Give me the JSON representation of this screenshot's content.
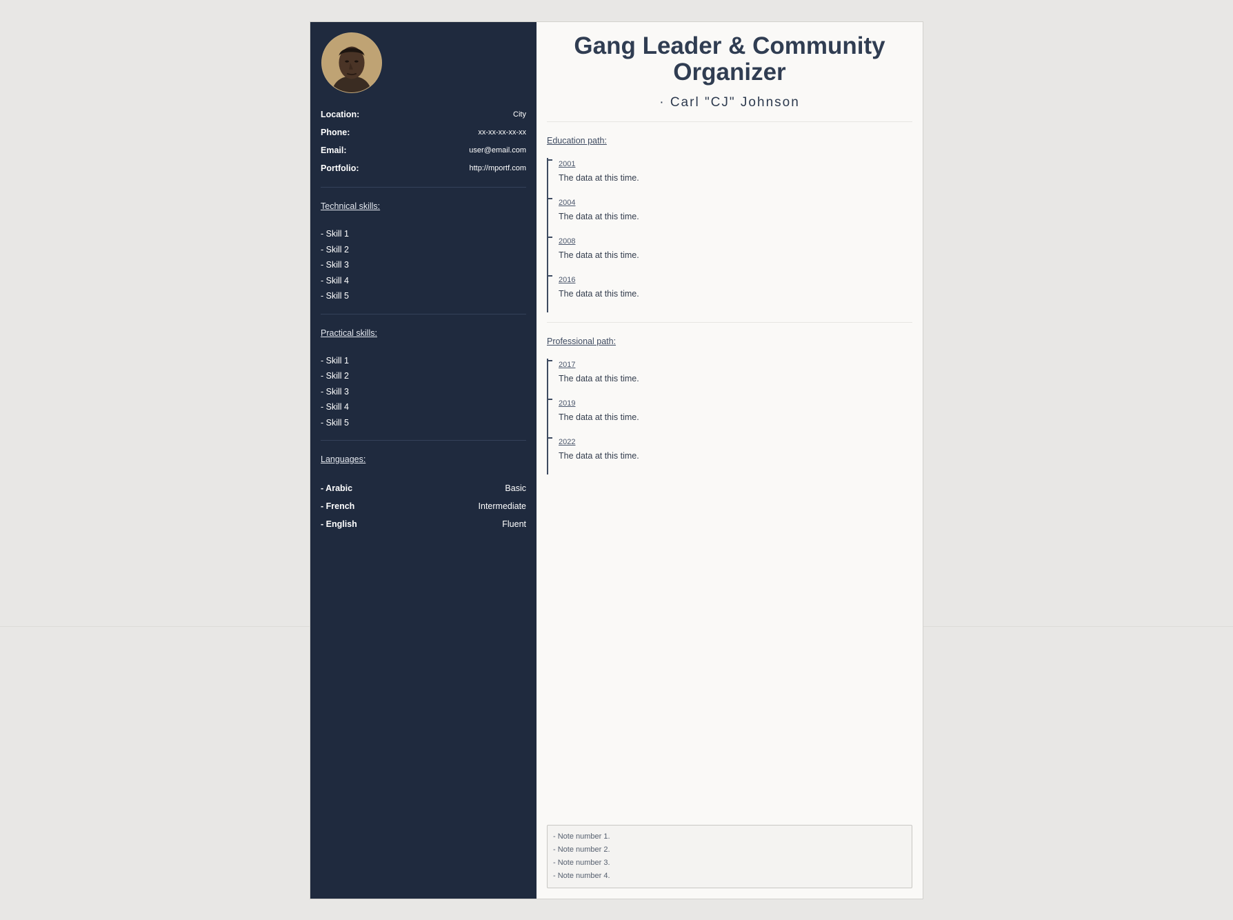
{
  "sidebar": {
    "contact": [
      {
        "label": "Location:",
        "value": "City"
      },
      {
        "label": "Phone:",
        "value": "xx-xx-xx-xx-xx"
      },
      {
        "label": "Email:",
        "value": "user@email.com"
      },
      {
        "label": "Portfolio:",
        "value": "http://mportf.com"
      }
    ],
    "technical_title": "Technical skills:",
    "technical_skills": [
      "- Skill 1",
      "- Skill 2",
      "- Skill 3",
      "- Skill 4",
      "- Skill 5"
    ],
    "practical_title": "Practical skills:",
    "practical_skills": [
      "- Skill 1",
      "- Skill 2",
      "- Skill 3",
      "- Skill 4",
      "- Skill 5"
    ],
    "languages_title": "Languages:",
    "languages": [
      {
        "name": "- Arabic",
        "level": "Basic"
      },
      {
        "name": "- French",
        "level": "Intermediate"
      },
      {
        "name": "- English",
        "level": "Fluent"
      }
    ]
  },
  "main": {
    "title_line1": "Gang Leader & Community",
    "title_line2": "Organizer",
    "name": "· Carl \"CJ\" Johnson",
    "education_title": "Education path:",
    "education": [
      {
        "year": "2001",
        "text": "The data at this time."
      },
      {
        "year": "2004",
        "text": "The data at this time."
      },
      {
        "year": "2008",
        "text": "The data at this time."
      },
      {
        "year": "2016",
        "text": "The data at this time."
      }
    ],
    "professional_title": "Professional path:",
    "professional": [
      {
        "year": "2017",
        "text": "The data at this time."
      },
      {
        "year": "2019",
        "text": "The data at this time."
      },
      {
        "year": "2022",
        "text": "The data at this time."
      }
    ],
    "notes": [
      "- Note number 1.",
      "- Note number 2.",
      "- Note number 3.",
      "- Note number 4."
    ]
  },
  "colors": {
    "sidebar_bg": "#1f2a3e",
    "page_bg": "#faf9f7",
    "accent_text": "#303d52"
  },
  "icons": {
    "avatar": "profile-photo"
  }
}
